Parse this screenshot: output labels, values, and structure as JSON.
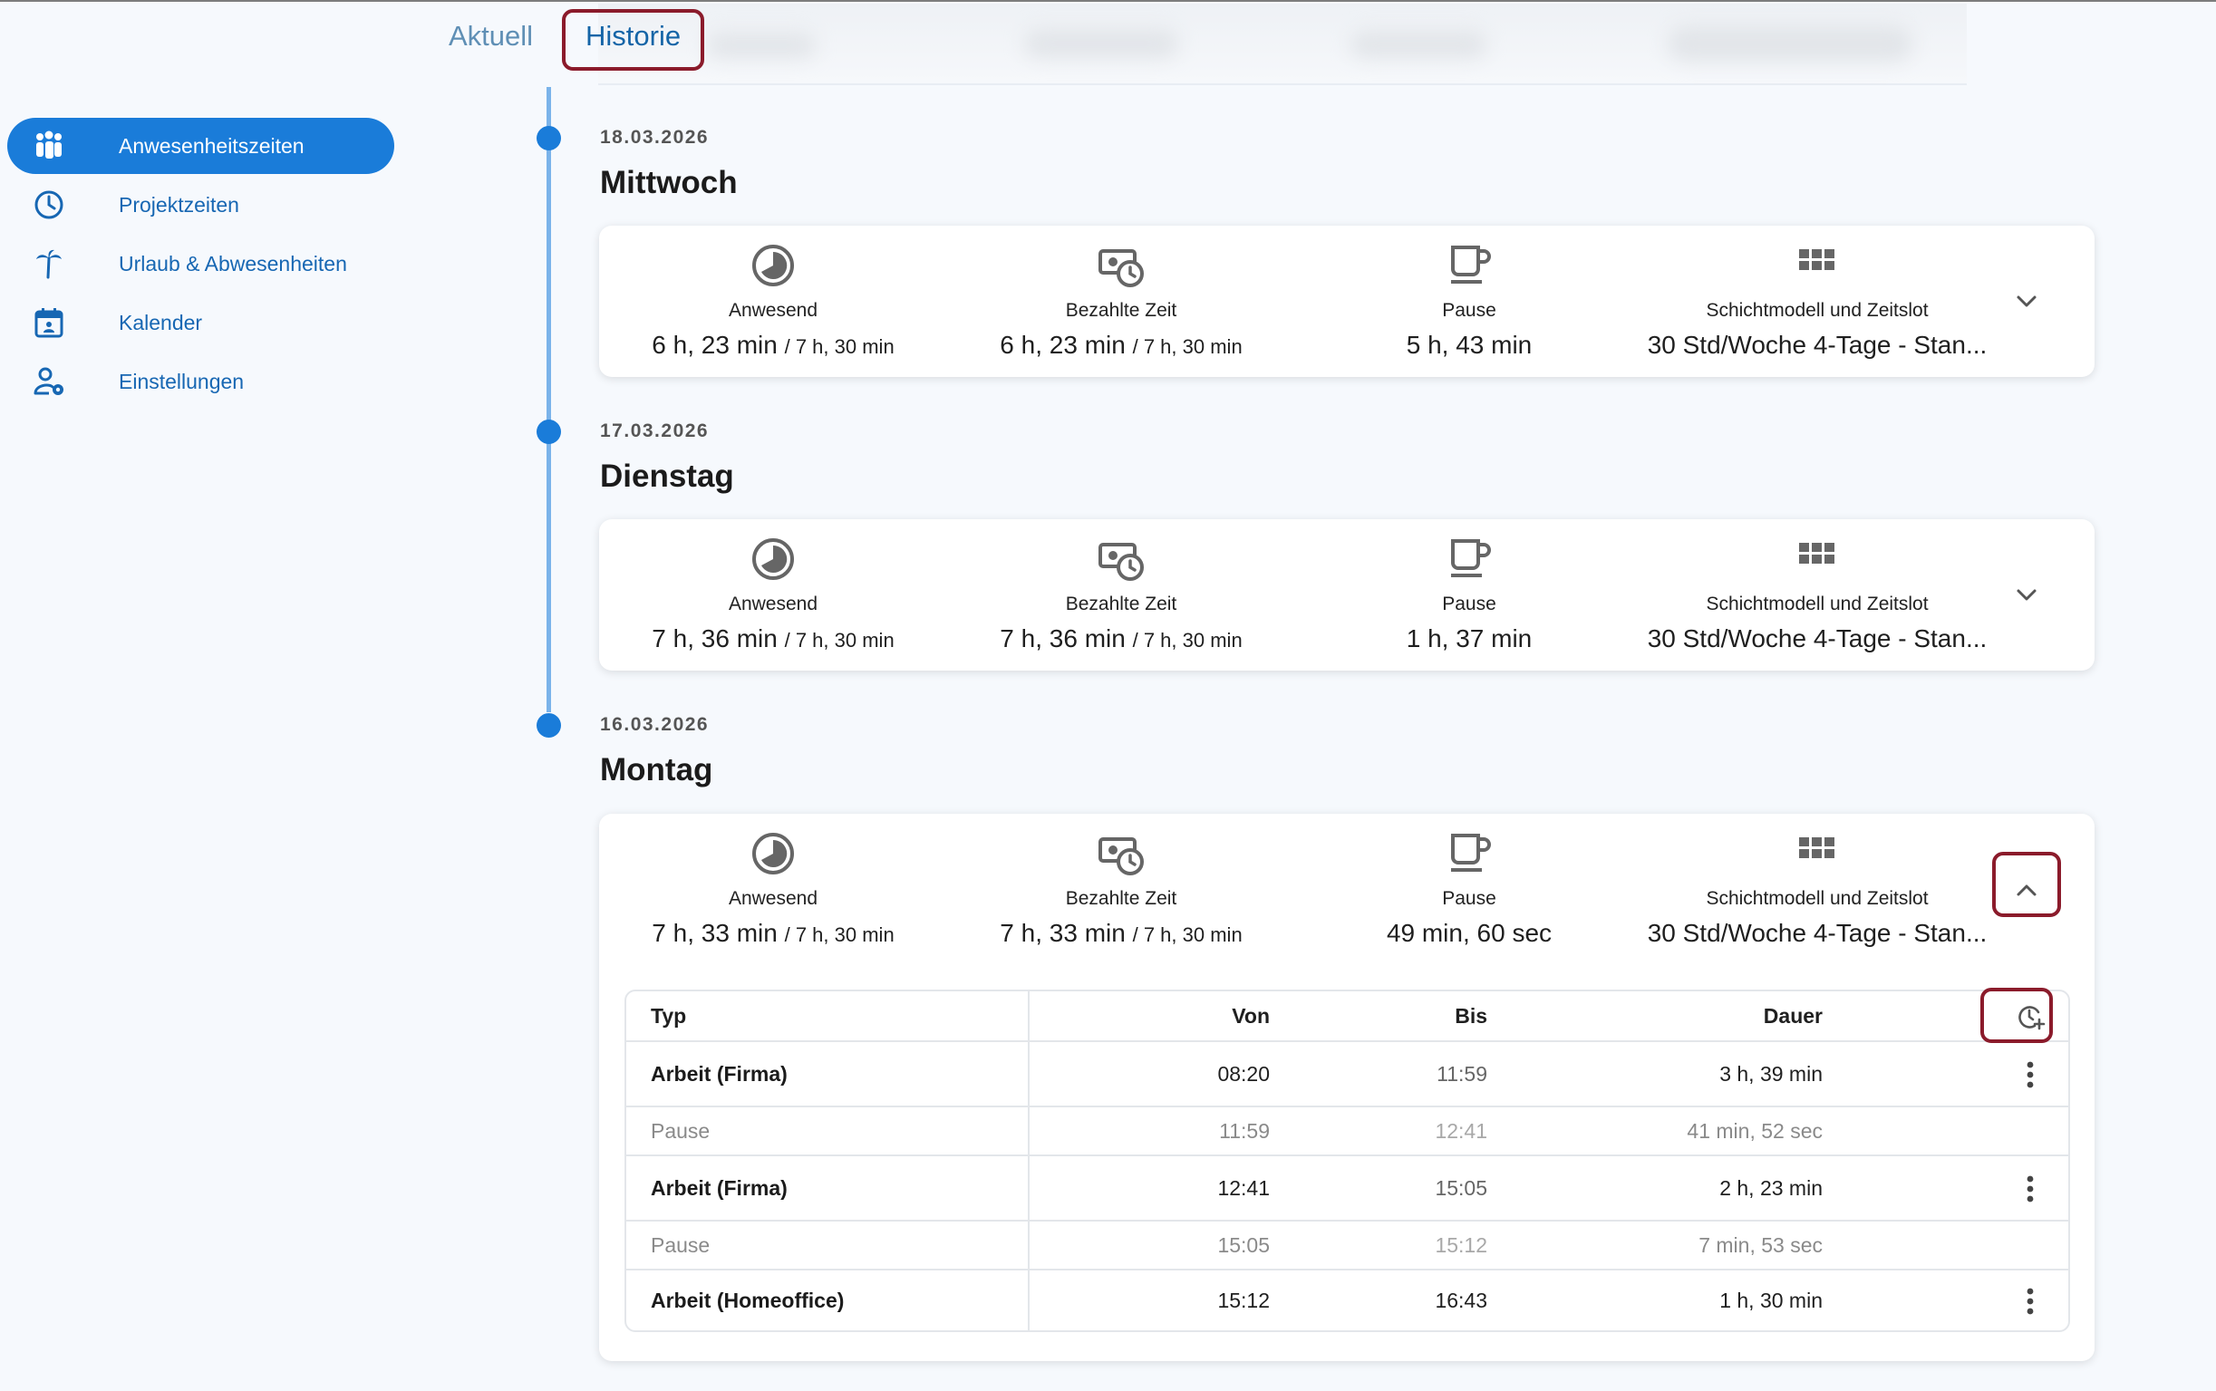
{
  "tabs": {
    "aktuell": "Aktuell",
    "historie": "Historie"
  },
  "sidebar": {
    "items": [
      {
        "label": "Anwesenheitszeiten",
        "icon": "people-icon",
        "active": true
      },
      {
        "label": "Projektzeiten",
        "icon": "clock-icon",
        "active": false
      },
      {
        "label": "Urlaub & Abwesenheiten",
        "icon": "palm-tree-icon",
        "active": false
      },
      {
        "label": "Kalender",
        "icon": "calendar-icon",
        "active": false
      },
      {
        "label": "Einstellungen",
        "icon": "user-settings-icon",
        "active": false
      }
    ]
  },
  "days": [
    {
      "date": "18.03.2026",
      "weekday": "Mittwoch",
      "anwesend_label": "Anwesend",
      "anwesend": "6 h, 23 min",
      "anwesend_target": "/ 7 h, 30 min",
      "bezahlt_label": "Bezahlte Zeit",
      "bezahlt": "6 h, 23 min",
      "bezahlt_target": "/ 7 h, 30 min",
      "pause_label": "Pause",
      "pause": "5 h, 43 min",
      "schicht_label": "Schichtmodell und Zeitslot",
      "schicht": "30 Std/Woche 4-Tage - Stan..."
    },
    {
      "date": "17.03.2026",
      "weekday": "Dienstag",
      "anwesend_label": "Anwesend",
      "anwesend": "7 h, 36 min",
      "anwesend_target": "/ 7 h, 30 min",
      "bezahlt_label": "Bezahlte Zeit",
      "bezahlt": "7 h, 36 min",
      "bezahlt_target": "/ 7 h, 30 min",
      "pause_label": "Pause",
      "pause": "1 h, 37 min",
      "schicht_label": "Schichtmodell und Zeitslot",
      "schicht": "30 Std/Woche 4-Tage - Stan..."
    },
    {
      "date": "16.03.2026",
      "weekday": "Montag",
      "anwesend_label": "Anwesend",
      "anwesend": "7 h, 33 min",
      "anwesend_target": "/ 7 h, 30 min",
      "bezahlt_label": "Bezahlte Zeit",
      "bezahlt": "7 h, 33 min",
      "bezahlt_target": "/ 7 h, 30 min",
      "pause_label": "Pause",
      "pause": "49 min, 60 sec",
      "schicht_label": "Schichtmodell und Zeitslot",
      "schicht": "30 Std/Woche 4-Tage - Stan..."
    }
  ],
  "table": {
    "headers": {
      "typ": "Typ",
      "von": "Von",
      "bis": "Bis",
      "dauer": "Dauer"
    },
    "rows": [
      {
        "typ": "Arbeit (Firma)",
        "von": "08:20",
        "bis": "11:59",
        "dauer": "3 h, 39 min",
        "kind": "work"
      },
      {
        "typ": "Pause",
        "von": "11:59",
        "bis": "12:41",
        "dauer": "41 min, 52 sec",
        "kind": "pause"
      },
      {
        "typ": "Arbeit (Firma)",
        "von": "12:41",
        "bis": "15:05",
        "dauer": "2 h, 23 min",
        "kind": "work"
      },
      {
        "typ": "Pause",
        "von": "15:05",
        "bis": "15:12",
        "dauer": "7 min, 53 sec",
        "kind": "pause"
      },
      {
        "typ": "Arbeit (Homeoffice)",
        "von": "15:12",
        "bis": "16:43",
        "dauer": "1 h, 30 min",
        "kind": "work"
      }
    ]
  },
  "colors": {
    "accent": "#1a7cd9",
    "highlight": "#8b1b2b",
    "timeline": "#7bb3ea"
  }
}
